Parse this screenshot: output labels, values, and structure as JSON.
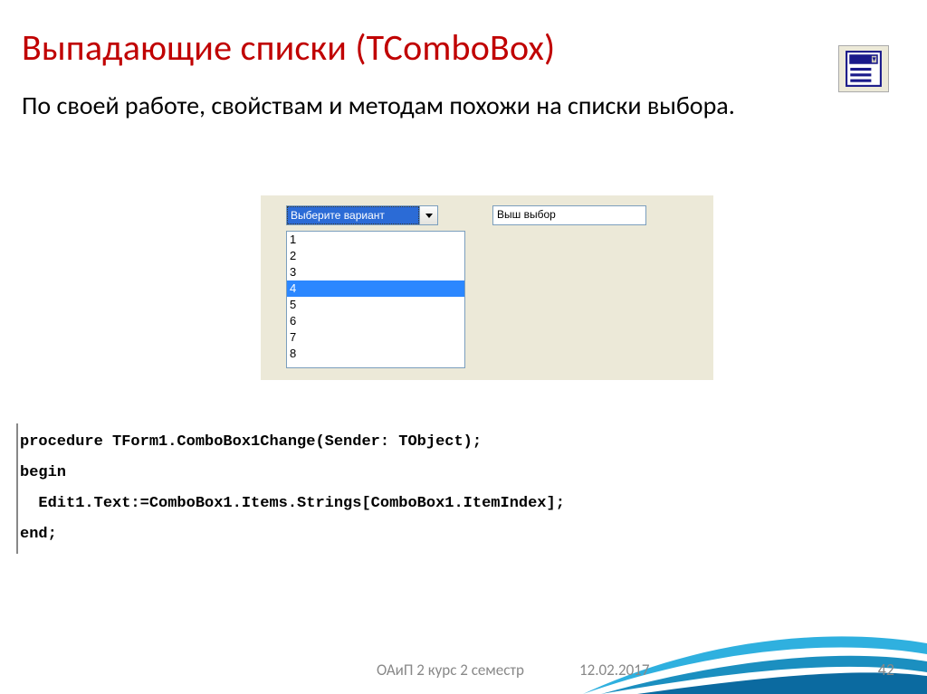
{
  "title": "Выпадающие списки (TComboBox)",
  "body": "По своей работе, свойствам и методам похожи на списки выбора.",
  "combo": {
    "selected_text": "Выберите вариант",
    "edit_value": "Выш выбор",
    "items": [
      "1",
      "2",
      "3",
      "4",
      "5",
      "6",
      "7",
      "8"
    ],
    "highlighted_index": 3
  },
  "code": "procedure TForm1.ComboBox1Change(Sender: TObject);\nbegin\n  Edit1.Text:=ComboBox1.Items.Strings[ComboBox1.ItemIndex];\nend;",
  "footer": {
    "course": "ОАиП 2 курс 2 семестр",
    "date": "12.02.2017",
    "page": "42"
  }
}
